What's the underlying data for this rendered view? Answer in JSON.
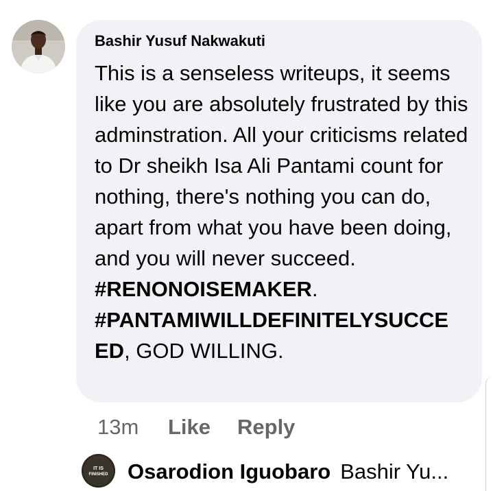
{
  "comment": {
    "author": "Bashir Yusuf Nakwakuti",
    "avatar_icon": "person-avatar-icon",
    "text_segments": [
      "This is a senseless writeups, it",
      "seems like you are absolutely",
      "frustrated by this adminstration. All",
      "your criticisms related to Dr sheikh",
      "Isa Ali Pantami count for nothing,",
      "there's nothing you can do, apart",
      "from what you have been doing,",
      "and you will never succeed."
    ],
    "hashtag_1": "#RENONOISEMAKER",
    "hashtag_1_suffix": ".",
    "hashtag_2_line1": "#PANTAMIWILLDEFINITELYSUCCE",
    "hashtag_2_line2": "ED",
    "closing": ", GOD WILLING.",
    "bubble_color": "#f0f2f5"
  },
  "actions": {
    "time": "13m",
    "like_label": "Like",
    "reply_label": "Reply"
  },
  "reply_preview": {
    "author": "Osarodion Iguobaro",
    "avatar_icon": "it-is-finished-avatar-icon",
    "avatar_text_top": "IT IS",
    "avatar_text_bottom": "FINISHED",
    "preview_text": "Bashir Yu..."
  },
  "colors": {
    "text": "#050505",
    "secondary": "#65676b"
  }
}
